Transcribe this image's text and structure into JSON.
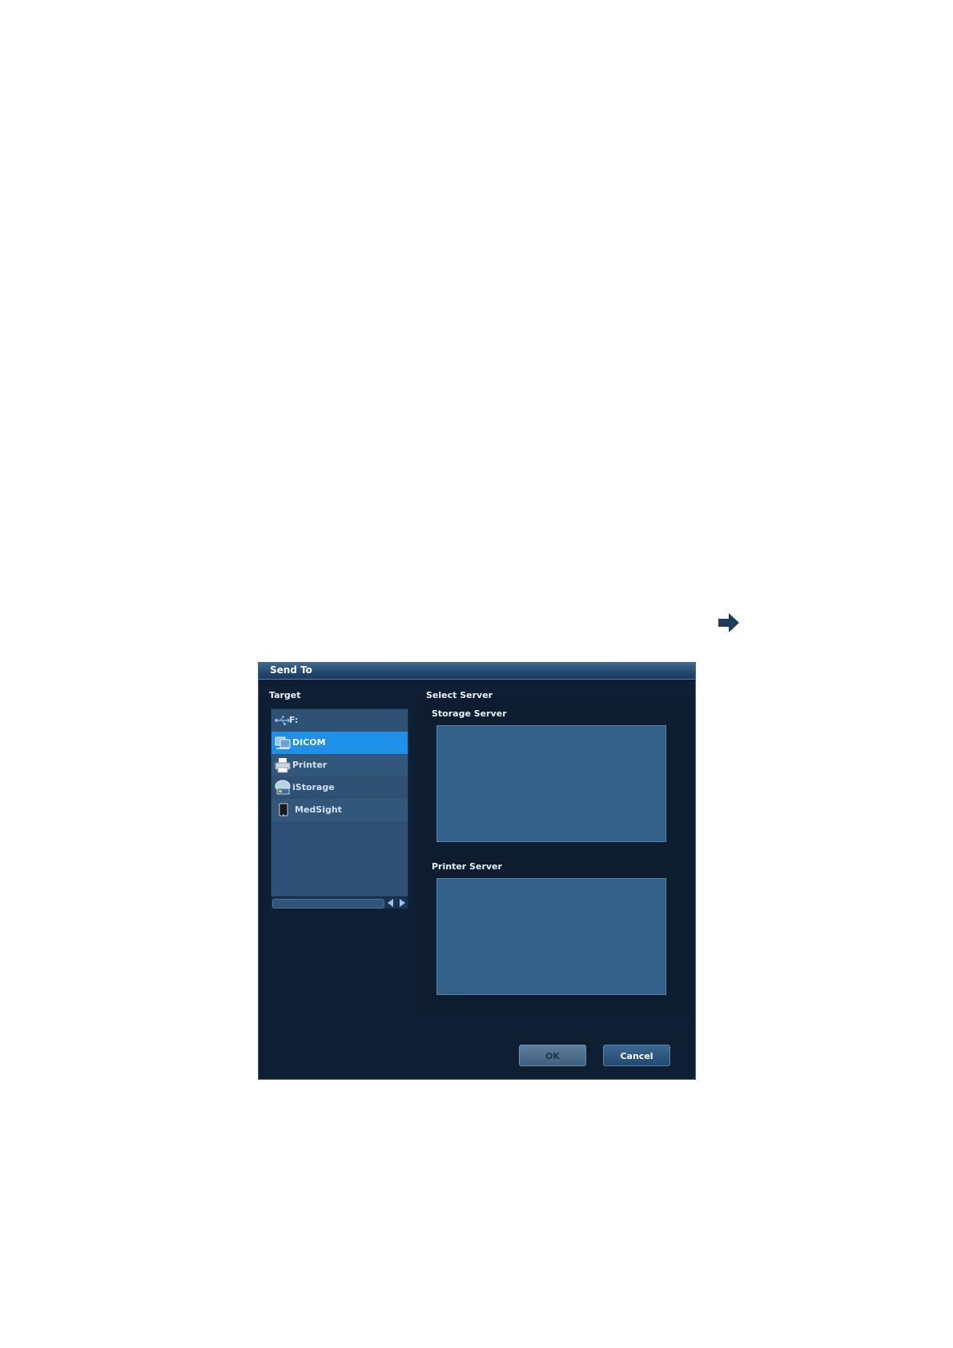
{
  "dialog": {
    "title": "Send To",
    "target_label": "Target",
    "select_server_label": "Select Server",
    "storage_server_label": "Storage Server",
    "printer_server_label": "Printer Server",
    "ok_label": "OK",
    "cancel_label": "Cancel"
  },
  "targets": [
    {
      "label": "F:",
      "icon": "usb-icon"
    },
    {
      "label": "DICOM",
      "icon": "dicom-icon",
      "selected": true
    },
    {
      "label": "Printer",
      "icon": "printer-icon"
    },
    {
      "label": "iStorage",
      "icon": "istorage-icon"
    },
    {
      "label": "MedSight",
      "icon": "tablet-icon"
    }
  ],
  "colors": {
    "selected_item": "#1e90e8",
    "dialog_bg": "#0f1f33",
    "server_box": "#325f88"
  }
}
